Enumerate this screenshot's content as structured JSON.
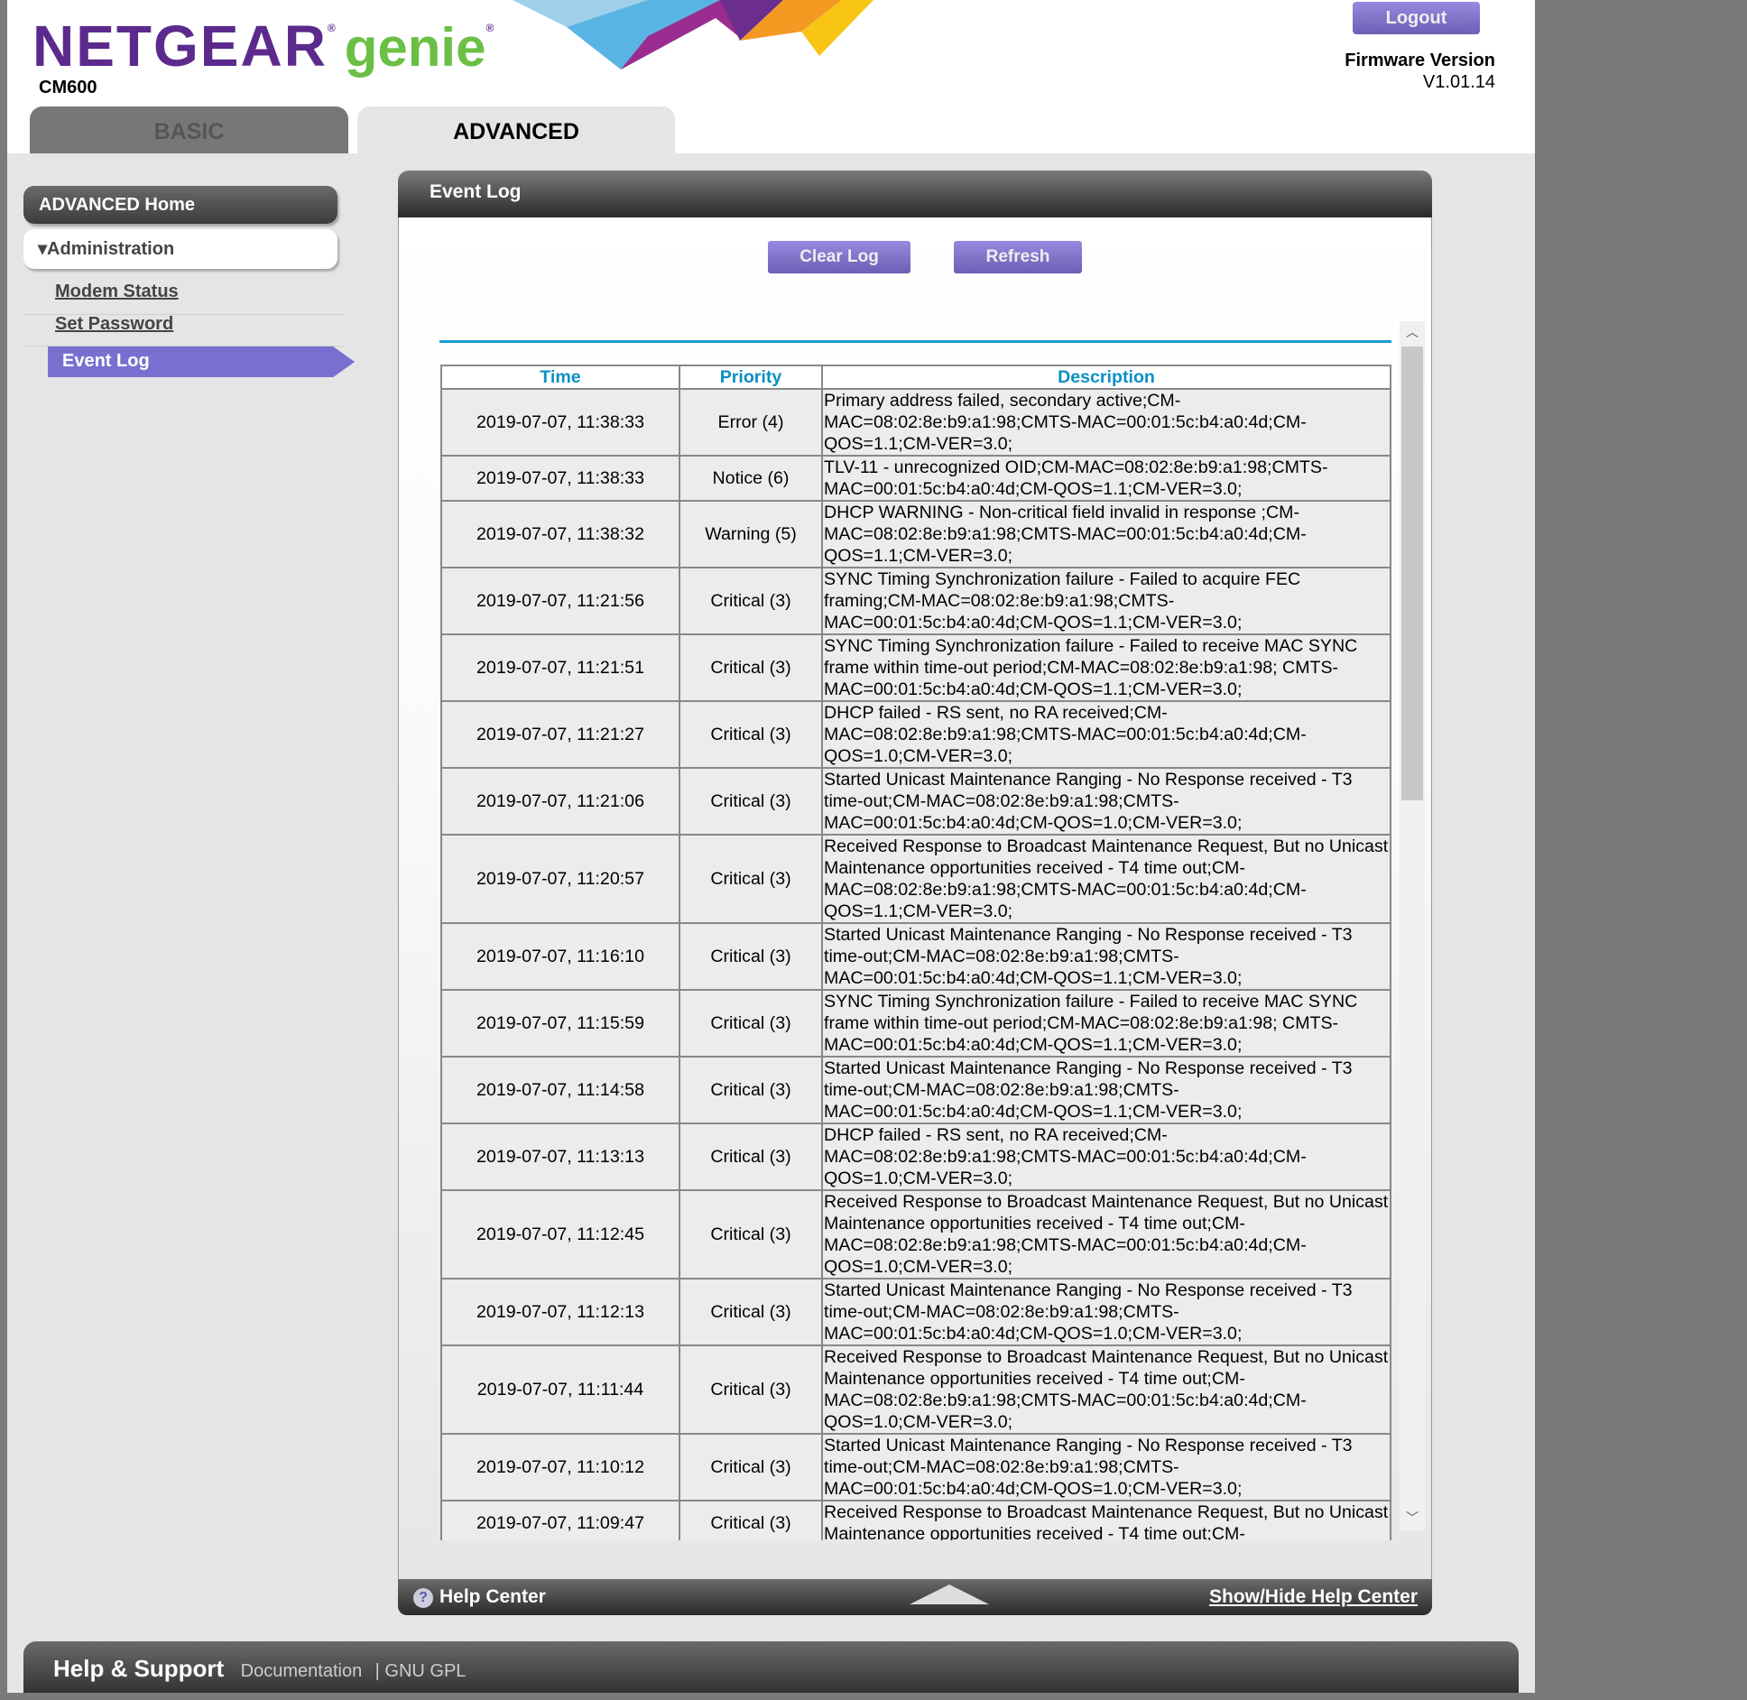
{
  "header": {
    "brand": "NETGEAR",
    "product": "genie",
    "model": "CM600",
    "logout": "Logout",
    "firmware_label": "Firmware Version",
    "firmware_value": "V1.01.14"
  },
  "tabs": [
    {
      "label": "BASIC",
      "active": false
    },
    {
      "label": "ADVANCED",
      "active": true
    }
  ],
  "sidebar": {
    "home": "ADVANCED Home",
    "section": "Administration",
    "items": [
      {
        "label": "Modem Status"
      },
      {
        "label": "Set Password"
      },
      {
        "label": "Event Log",
        "active": true
      }
    ]
  },
  "panel": {
    "title": "Event Log",
    "clear": "Clear Log",
    "refresh": "Refresh",
    "help": "Help Center",
    "toggle_help": "Show/Hide Help Center"
  },
  "table": {
    "headers": [
      "Time",
      "Priority",
      "Description"
    ],
    "rows": [
      [
        "2019-07-07, 11:38:33",
        "Error (4)",
        "Primary address failed, secondary active;CM-MAC=08:02:8e:b9:a1:98;CMTS-MAC=00:01:5c:b4:a0:4d;CM-QOS=1.1;CM-VER=3.0;"
      ],
      [
        "2019-07-07, 11:38:33",
        "Notice (6)",
        "TLV-11 - unrecognized OID;CM-MAC=08:02:8e:b9:a1:98;CMTS-MAC=00:01:5c:b4:a0:4d;CM-QOS=1.1;CM-VER=3.0;"
      ],
      [
        "2019-07-07, 11:38:32",
        "Warning (5)",
        "DHCP WARNING - Non-critical field invalid in response ;CM-MAC=08:02:8e:b9:a1:98;CMTS-MAC=00:01:5c:b4:a0:4d;CM-QOS=1.1;CM-VER=3.0;"
      ],
      [
        "2019-07-07, 11:21:56",
        "Critical (3)",
        "SYNC Timing Synchronization failure - Failed to acquire FEC framing;CM-MAC=08:02:8e:b9:a1:98;CMTS-MAC=00:01:5c:b4:a0:4d;CM-QOS=1.1;CM-VER=3.0;"
      ],
      [
        "2019-07-07, 11:21:51",
        "Critical (3)",
        "SYNC Timing Synchronization failure - Failed to receive MAC SYNC frame within time-out period;CM-MAC=08:02:8e:b9:a1:98; CMTS-MAC=00:01:5c:b4:a0:4d;CM-QOS=1.1;CM-VER=3.0;"
      ],
      [
        "2019-07-07, 11:21:27",
        "Critical (3)",
        "DHCP failed - RS sent, no RA received;CM-MAC=08:02:8e:b9:a1:98;CMTS-MAC=00:01:5c:b4:a0:4d;CM-QOS=1.0;CM-VER=3.0;"
      ],
      [
        "2019-07-07, 11:21:06",
        "Critical (3)",
        "Started Unicast Maintenance Ranging - No Response received - T3 time-out;CM-MAC=08:02:8e:b9:a1:98;CMTS-MAC=00:01:5c:b4:a0:4d;CM-QOS=1.0;CM-VER=3.0;"
      ],
      [
        "2019-07-07, 11:20:57",
        "Critical (3)",
        "Received Response to Broadcast Maintenance Request, But no Unicast Maintenance opportunities received - T4 time out;CM-MAC=08:02:8e:b9:a1:98;CMTS-MAC=00:01:5c:b4:a0:4d;CM-QOS=1.1;CM-VER=3.0;"
      ],
      [
        "2019-07-07, 11:16:10",
        "Critical (3)",
        "Started Unicast Maintenance Ranging - No Response received - T3 time-out;CM-MAC=08:02:8e:b9:a1:98;CMTS-MAC=00:01:5c:b4:a0:4d;CM-QOS=1.1;CM-VER=3.0;"
      ],
      [
        "2019-07-07, 11:15:59",
        "Critical (3)",
        "SYNC Timing Synchronization failure - Failed to receive MAC SYNC frame within time-out period;CM-MAC=08:02:8e:b9:a1:98; CMTS-MAC=00:01:5c:b4:a0:4d;CM-QOS=1.1;CM-VER=3.0;"
      ],
      [
        "2019-07-07, 11:14:58",
        "Critical (3)",
        "Started Unicast Maintenance Ranging - No Response received - T3 time-out;CM-MAC=08:02:8e:b9:a1:98;CMTS-MAC=00:01:5c:b4:a0:4d;CM-QOS=1.1;CM-VER=3.0;"
      ],
      [
        "2019-07-07, 11:13:13",
        "Critical (3)",
        "DHCP failed - RS sent, no RA received;CM-MAC=08:02:8e:b9:a1:98;CMTS-MAC=00:01:5c:b4:a0:4d;CM-QOS=1.0;CM-VER=3.0;"
      ],
      [
        "2019-07-07, 11:12:45",
        "Critical (3)",
        "Received Response to Broadcast Maintenance Request, But no Unicast Maintenance opportunities received - T4 time out;CM-MAC=08:02:8e:b9:a1:98;CMTS-MAC=00:01:5c:b4:a0:4d;CM-QOS=1.0;CM-VER=3.0;"
      ],
      [
        "2019-07-07, 11:12:13",
        "Critical (3)",
        "Started Unicast Maintenance Ranging - No Response received - T3 time-out;CM-MAC=08:02:8e:b9:a1:98;CMTS-MAC=00:01:5c:b4:a0:4d;CM-QOS=1.0;CM-VER=3.0;"
      ],
      [
        "2019-07-07, 11:11:44",
        "Critical (3)",
        "Received Response to Broadcast Maintenance Request, But no Unicast Maintenance opportunities received - T4 time out;CM-MAC=08:02:8e:b9:a1:98;CMTS-MAC=00:01:5c:b4:a0:4d;CM-QOS=1.0;CM-VER=3.0;"
      ],
      [
        "2019-07-07, 11:10:12",
        "Critical (3)",
        "Started Unicast Maintenance Ranging - No Response received - T3 time-out;CM-MAC=08:02:8e:b9:a1:98;CMTS-MAC=00:01:5c:b4:a0:4d;CM-QOS=1.0;CM-VER=3.0;"
      ],
      [
        "2019-07-07, 11:09:47",
        "Critical (3)",
        "Received Response to Broadcast Maintenance Request, But no Unicast Maintenance opportunities received - T4 time out;CM-"
      ]
    ]
  },
  "footer": {
    "title": "Help & Support",
    "links": [
      "Documentation",
      "| GNU GPL"
    ]
  },
  "colors": {
    "brand_purple": "#5b2a8c",
    "genie_green": "#6cbf45",
    "button": "#7a6fd0",
    "header_text": "#0b8fc4"
  }
}
